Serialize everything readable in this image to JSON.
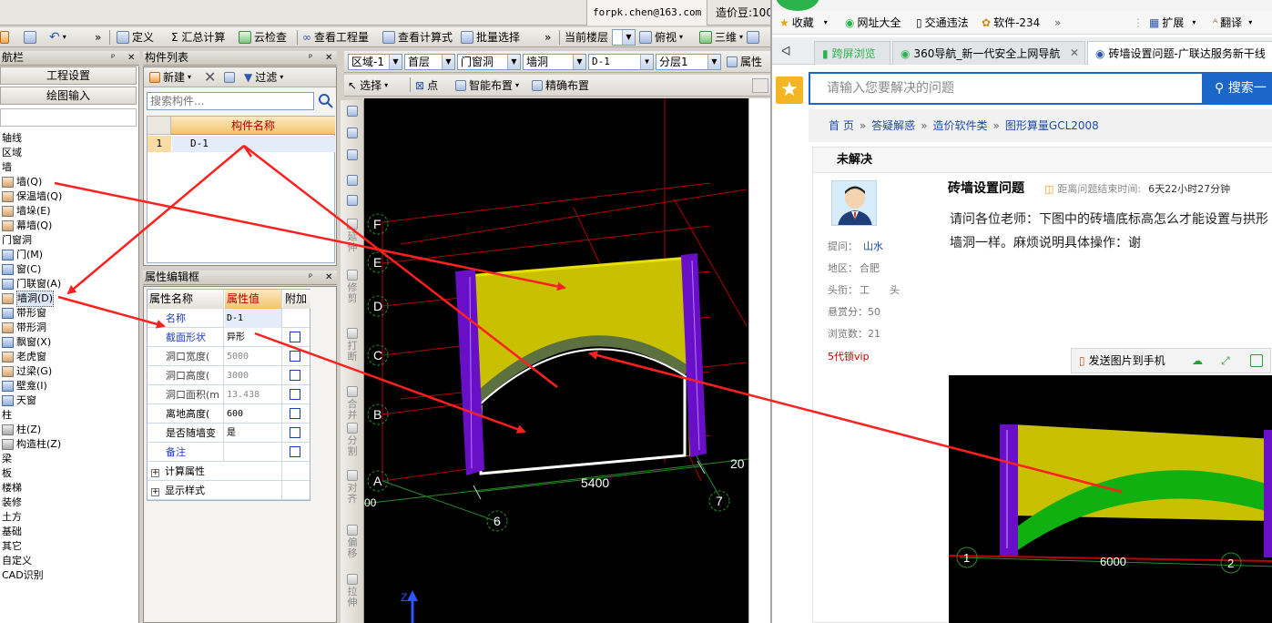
{
  "cad": {
    "account_email": "forpk.chen@163.com",
    "cost_label": "造价豆:100",
    "toolbar1": {
      "define": "定义",
      "sum_calc": "Σ 汇总计算",
      "cloud_check": "云检查",
      "view_quantity": "查看工程量",
      "view_formula": "查看计算式",
      "batch_select": "批量选择",
      "current_floor": "当前楼层",
      "top_view": "俯视",
      "threed": "三维",
      "overflow": "»"
    },
    "toolbar2": {
      "region": "区域-1",
      "floor": "首层",
      "category": "门窗洞",
      "type": "墙洞",
      "component": "D-1",
      "layer": "分层1",
      "properties": "属性"
    },
    "toolbar3": {
      "select": "选择",
      "point": "点",
      "smart_layout": "智能布置",
      "precise_layout": "精确布置"
    },
    "nav_panel": {
      "title": "航栏",
      "project_settings": "工程设置",
      "drawing_input": "绘图输入",
      "tree": [
        {
          "label": "轴线",
          "icon": "",
          "sub": false
        },
        {
          "label": "区域",
          "icon": "",
          "sub": false
        },
        {
          "label": "墙",
          "icon": "",
          "sub": false
        },
        {
          "label": "墙(Q)",
          "icon": "wall-icon",
          "sub": true
        },
        {
          "label": "保温墙(Q)",
          "icon": "insulated-wall-icon",
          "sub": true
        },
        {
          "label": "墙垛(E)",
          "icon": "wall-pier-icon",
          "sub": true
        },
        {
          "label": "幕墙(Q)",
          "icon": "curtain-wall-icon",
          "sub": true
        },
        {
          "label": "门窗洞",
          "icon": "",
          "sub": false
        },
        {
          "label": "门(M)",
          "icon": "door-icon",
          "sub": true
        },
        {
          "label": "窗(C)",
          "icon": "window-icon",
          "sub": true
        },
        {
          "label": "门联窗(A)",
          "icon": "door-window-icon",
          "sub": true
        },
        {
          "label": "墙洞(D)",
          "icon": "wall-opening-icon",
          "sub": true,
          "selected": true
        },
        {
          "label": "带形窗",
          "icon": "strip-window-icon",
          "sub": true
        },
        {
          "label": "带形洞",
          "icon": "strip-opening-icon",
          "sub": true
        },
        {
          "label": "飘窗(X)",
          "icon": "bay-window-icon",
          "sub": true
        },
        {
          "label": "老虎窗",
          "icon": "dormer-icon",
          "sub": true
        },
        {
          "label": "过梁(G)",
          "icon": "lintel-icon",
          "sub": true
        },
        {
          "label": "壁龛(I)",
          "icon": "niche-icon",
          "sub": true
        },
        {
          "label": "天窗",
          "icon": "skylight-icon",
          "sub": true
        },
        {
          "label": "柱",
          "icon": "",
          "sub": false
        },
        {
          "label": "柱(Z)",
          "icon": "column-icon",
          "sub": true
        },
        {
          "label": "构造柱(Z)",
          "icon": "constructional-column-icon",
          "sub": true
        },
        {
          "label": "梁",
          "icon": "",
          "sub": false
        },
        {
          "label": "板",
          "icon": "",
          "sub": false
        },
        {
          "label": "楼梯",
          "icon": "",
          "sub": false
        },
        {
          "label": "装修",
          "icon": "",
          "sub": false
        },
        {
          "label": "土方",
          "icon": "",
          "sub": false
        },
        {
          "label": "基础",
          "icon": "",
          "sub": false
        },
        {
          "label": "其它",
          "icon": "",
          "sub": false
        },
        {
          "label": "自定义",
          "icon": "",
          "sub": false
        },
        {
          "label": "CAD识别",
          "icon": "",
          "sub": false
        }
      ]
    },
    "component_list": {
      "title": "构件列表",
      "new_label": "新建",
      "filter_label": "过滤",
      "search_placeholder": "搜索构件...",
      "column_header": "构件名称",
      "rows": [
        {
          "num": "1",
          "name": "D-1"
        }
      ]
    },
    "property_editor": {
      "title": "属性编辑框",
      "headers": {
        "name": "属性名称",
        "value": "属性值",
        "extra": "附加"
      },
      "rows": [
        {
          "name": "名称",
          "value": "D-1",
          "style": "blue",
          "checkbox": false
        },
        {
          "name": "截面形状",
          "value": "异形",
          "style": "blue",
          "checkbox": true
        },
        {
          "name": "洞口宽度(",
          "value": "5000",
          "style": "gray",
          "dim": true,
          "checkbox": true
        },
        {
          "name": "洞口高度(",
          "value": "3000",
          "style": "gray",
          "dim": true,
          "checkbox": true
        },
        {
          "name": "洞口面积(m",
          "value": "13.438",
          "style": "gray",
          "dim": true,
          "checkbox": true
        },
        {
          "name": "离地高度(",
          "value": "600",
          "style": "plain",
          "checkbox": true
        },
        {
          "name": "是否随墙变",
          "value": "是",
          "style": "plain",
          "checkbox": true
        },
        {
          "name": "备注",
          "value": "",
          "style": "blue",
          "checkbox": true
        }
      ],
      "groups": [
        "计算属性",
        "显示样式"
      ]
    },
    "vertical_tools": [
      "延伸",
      "修剪",
      "打断",
      "合并",
      "分割",
      "对齐",
      "偏移",
      "拉伸"
    ],
    "canvas": {
      "axis_letters": [
        "F",
        "E",
        "D",
        "C",
        "B",
        "A"
      ],
      "axis_numbers": [
        "6",
        "7"
      ],
      "dimension": "5400",
      "partial_dim_right": "20",
      "partial_dim_left": "00",
      "axis_z": "Z",
      "colors": {
        "wall_fill": "#c8c000",
        "column": "#6a0fc8",
        "arch": "#5c7040",
        "grid": "#c00000",
        "green_line": "#2a8c2a"
      }
    }
  },
  "browser": {
    "bookmarks": [
      "收藏",
      "网址大全",
      "交通违法",
      "软件-234"
    ],
    "bookmark_overflow": "»",
    "extensions_label": "扩展",
    "translate_label": "翻译",
    "tabs": [
      {
        "label": "跨屏浏览",
        "active": false
      },
      {
        "label": "360导航_新一代安全上网导航",
        "active": false
      },
      {
        "label": "砖墙设置问题-广联达服务新干线",
        "active": true
      }
    ],
    "search_placeholder": "请输入您要解决的问题",
    "search_button": "搜索一",
    "breadcrumb": [
      "首 页",
      "答疑解惑",
      "造价软件类",
      "图形算量GCL2008"
    ],
    "breadcrumb_sep": "»",
    "question": {
      "status": "未解决",
      "title": "砖墙设置问题",
      "time_label": "距离问题结束时间:",
      "time_value": "6天22小时27分钟",
      "body": "请问各位老师：下图中的砖墙底标高怎么才能设置与拱形墙洞一样。麻烦说明具体操作：谢",
      "asker_label": "提问：",
      "asker": "山水",
      "region_label": "地区：",
      "region": "合肥",
      "title_label": "头衔：",
      "title_value": "工　　头",
      "bounty_label": "悬赏分：",
      "bounty": "50",
      "views_label": "浏览数：",
      "views": "21",
      "vip": "5代锁vip"
    },
    "image_toolbar": {
      "send_to_phone": "发送图片到手机"
    },
    "attached_image": {
      "axis_left": "1",
      "axis_right": "2",
      "dimension": "6000"
    }
  }
}
